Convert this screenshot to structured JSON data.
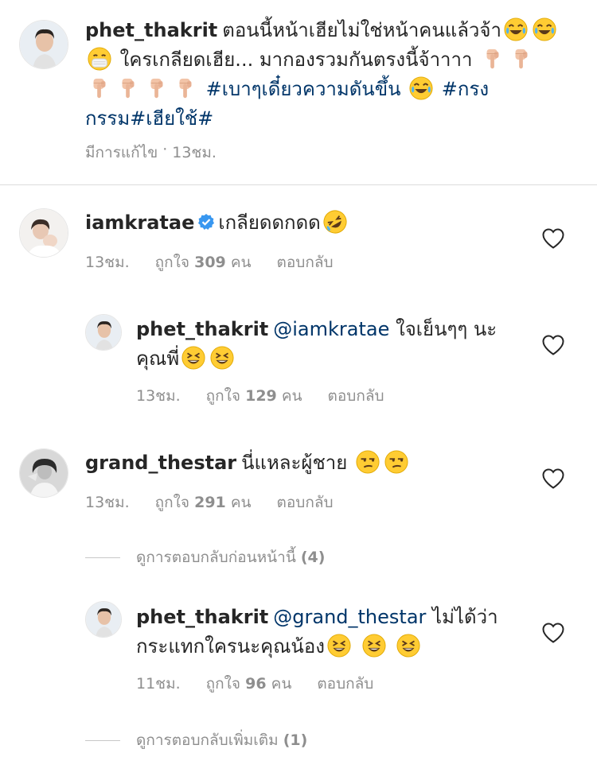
{
  "caption": {
    "username": "phet_thakrit",
    "line1_text": "ตอนนี้หน้าเฮียไม่ใช่หน้าคนแล้วจ้า",
    "line2_text": "ใครเกลียดเฮีย... มากองรวมกันตรงนี้จ้าาาา",
    "hashtag1": "#เบาๆเดี๋ยวความดันขึ้น",
    "hashtag2": "#กรงกรรม#เฮียใช้#",
    "edited_label": "มีการแก้ไข",
    "separator": "·",
    "time": "13ชม."
  },
  "comments": [
    {
      "username": "iamkratae",
      "verified": true,
      "text": "เกลียดดกดด",
      "time": "13ชม.",
      "likes_prefix": "ถูกใจ",
      "likes_count": "309",
      "likes_suffix": "คน",
      "reply_label": "ตอบกลับ"
    },
    {
      "username": "phet_thakrit",
      "mention": "@iamkratae",
      "text": "ใจเย็นๆๆ นะคุณพี่",
      "time": "13ชม.",
      "likes_prefix": "ถูกใจ",
      "likes_count": "129",
      "likes_suffix": "คน",
      "reply_label": "ตอบกลับ"
    },
    {
      "username": "grand_thestar",
      "text": "นี่แหละผู้ชาย",
      "time": "13ชม.",
      "likes_prefix": "ถูกใจ",
      "likes_count": "291",
      "likes_suffix": "คน",
      "reply_label": "ตอบกลับ"
    },
    {
      "username": "phet_thakrit",
      "mention": "@grand_thestar",
      "text_line1": "ไม่ได้ว่า",
      "text_line2": "กระแทกใครนะคุณน้อง",
      "time": "11ชม.",
      "likes_prefix": "ถูกใจ",
      "likes_count": "96",
      "likes_suffix": "คน",
      "reply_label": "ตอบกลับ"
    }
  ],
  "view_previous": {
    "label": "ดูการตอบกลับก่อนหน้านี้",
    "count": "(4)"
  },
  "view_more": {
    "label": "ดูการตอบกลับเพิ่มเติม",
    "count": "(1)"
  },
  "icons": {
    "heart": "heart-outline-icon",
    "verified": "verified-badge-icon",
    "emoji_laugh": "face-with-tears-of-joy",
    "emoji_mask": "face-with-medical-mask",
    "emoji_point": "backhand-index-pointing-down",
    "emoji_rofl": "rolling-on-floor-laughing",
    "emoji_grin": "grinning-squinting-face",
    "emoji_unamused": "unamused-face"
  },
  "colors": {
    "text": "#262626",
    "secondary": "#8e8e8e",
    "link": "#003569",
    "verified": "#3897f0",
    "divider": "#dbdbdb",
    "background": "#ffffff"
  }
}
